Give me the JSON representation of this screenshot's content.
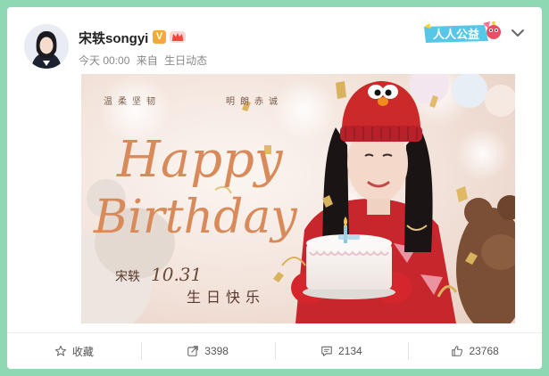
{
  "post": {
    "author": "宋轶songyi",
    "verified_badge": "V",
    "timestamp": "今天 00:00",
    "source_prefix": "来自",
    "source": "生日动态",
    "gongyi_badge": "人人公益"
  },
  "image": {
    "tagline_left": "温柔坚韧",
    "tagline_right": "明朗赤诚",
    "headline_line1": "Happy",
    "headline_line2": "Birthday",
    "name": "宋轶",
    "date": "10.31",
    "wish": "生日快乐"
  },
  "actions": {
    "favorite_label": "收藏",
    "repost_count": "3398",
    "comment_count": "2134",
    "like_count": "23768"
  },
  "colors": {
    "page_background": "#8fd8b4",
    "headline": "#d98a5a",
    "hat_red": "#cc2a2a",
    "vip_orange": "#f6a83a"
  },
  "icons": [
    "star-icon",
    "repost-icon",
    "comment-icon",
    "like-icon",
    "chevron-down-icon",
    "crown-icon"
  ]
}
